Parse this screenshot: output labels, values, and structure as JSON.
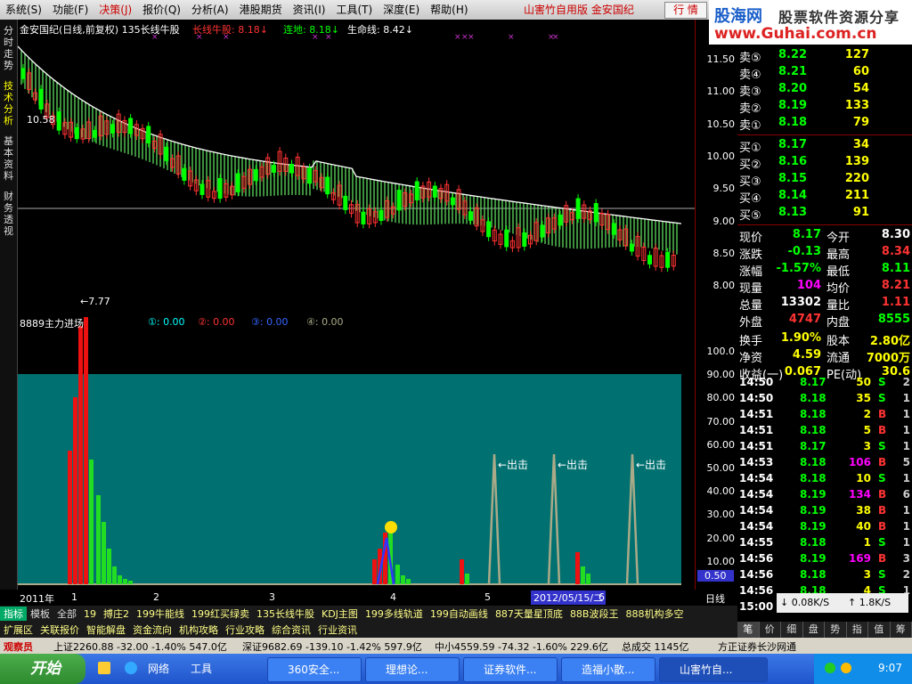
{
  "menu": [
    "系统(S)",
    "功能(F)",
    "决策(J)",
    "报价(Q)",
    "分析(A)",
    "港股期货",
    "资讯(I)",
    "工具(T)",
    "深度(E)",
    "帮助(H)"
  ],
  "menu_active_index": 2,
  "app_title": "山害竹自用版 金安国纪",
  "hq_button": "行 情",
  "logo": {
    "brand": "股海网",
    "slogan": "股票软件资源分享",
    "url": "www.Guhai.com.cn"
  },
  "vtabs": [
    "分时走势",
    "技术分析",
    "基本资料",
    "财务透视"
  ],
  "vtab_active_index": 1,
  "chart_legend": {
    "title": "金安国纪(日线,前复权) 135长线牛股",
    "l1": "长线牛股: 8.18↓",
    "l2": "连地: 8.18↓",
    "l3": "生命线: 8.42↓"
  },
  "price_marks": {
    "high": "10.58",
    "low": "←7.77"
  },
  "indicator_legend": {
    "name": "8889主力进场",
    "v1": "①: 0.00",
    "v2": "②: 0.00",
    "v3": "③: 0.00",
    "v4": "④: 0.00"
  },
  "exit_label": "←出击",
  "price_axis": [
    "11.50",
    "11.00",
    "10.50",
    "10.00",
    "9.50",
    "9.00",
    "8.50",
    "8.00"
  ],
  "ind_axis": [
    "100.0",
    "90.00",
    "80.00",
    "70.00",
    "60.00",
    "50.00",
    "40.00",
    "30.00",
    "20.00",
    "10.00"
  ],
  "ind_axis_current": "0.50",
  "time_axis": {
    "year": "2011年",
    "labels": [
      "1",
      "2",
      "3",
      "4",
      "5",
      "6"
    ],
    "cursor": "2012/05/15/二",
    "period": "日线"
  },
  "quote": {
    "asks": [
      {
        "label": "卖⑤",
        "price": "8.22",
        "vol": "127"
      },
      {
        "label": "卖④",
        "price": "8.21",
        "vol": "60"
      },
      {
        "label": "卖③",
        "price": "8.20",
        "vol": "54"
      },
      {
        "label": "卖②",
        "price": "8.19",
        "vol": "133"
      },
      {
        "label": "卖①",
        "price": "8.18",
        "vol": "79"
      }
    ],
    "bids": [
      {
        "label": "买①",
        "price": "8.17",
        "vol": "34"
      },
      {
        "label": "买②",
        "price": "8.16",
        "vol": "139"
      },
      {
        "label": "买③",
        "price": "8.15",
        "vol": "220"
      },
      {
        "label": "买④",
        "price": "8.14",
        "vol": "211"
      },
      {
        "label": "买⑤",
        "price": "8.13",
        "vol": "91"
      }
    ],
    "stats": [
      {
        "k1": "现价",
        "v1": "8.17",
        "c1": "#0f0",
        "k2": "今开",
        "v2": "8.30",
        "c2": "#fff"
      },
      {
        "k1": "涨跌",
        "v1": "-0.13",
        "c1": "#0f0",
        "k2": "最高",
        "v2": "8.34",
        "c2": "#f33"
      },
      {
        "k1": "涨幅",
        "v1": "-1.57%",
        "c1": "#0f0",
        "k2": "最低",
        "v2": "8.11",
        "c2": "#0f0"
      },
      {
        "k1": "现量",
        "v1": "104",
        "c1": "#f0f",
        "k2": "均价",
        "v2": "8.21",
        "c2": "#f33"
      },
      {
        "k1": "总量",
        "v1": "13302",
        "c1": "#fff",
        "k2": "量比",
        "v2": "1.11",
        "c2": "#f33"
      },
      {
        "k1": "外盘",
        "v1": "4747",
        "c1": "#f33",
        "k2": "内盘",
        "v2": "8555",
        "c2": "#0f0"
      },
      {
        "k1": "换手",
        "v1": "1.90%",
        "c1": "#ff0",
        "k2": "股本",
        "v2": "2.80亿",
        "c2": "#ff0"
      },
      {
        "k1": "净资",
        "v1": "4.59",
        "c1": "#ff0",
        "k2": "流通",
        "v2": "7000万",
        "c2": "#ff0"
      },
      {
        "k1": "收益(一)",
        "v1": "0.067",
        "c1": "#ff0",
        "k2": "PE(动)",
        "v2": "30.6",
        "c2": "#ff0"
      }
    ]
  },
  "ticks": [
    {
      "t": "14:50",
      "p": "8.17",
      "v": "50",
      "s": "S",
      "n": "2"
    },
    {
      "t": "14:50",
      "p": "8.18",
      "v": "35",
      "s": "S",
      "n": "1"
    },
    {
      "t": "14:51",
      "p": "8.18",
      "v": "2",
      "s": "B",
      "n": "1"
    },
    {
      "t": "14:51",
      "p": "8.18",
      "v": "5",
      "s": "B",
      "n": "1"
    },
    {
      "t": "14:51",
      "p": "8.17",
      "v": "3",
      "s": "S",
      "n": "1"
    },
    {
      "t": "14:53",
      "p": "8.18",
      "v": "106",
      "s": "B",
      "n": "5"
    },
    {
      "t": "14:54",
      "p": "8.18",
      "v": "10",
      "s": "S",
      "n": "1"
    },
    {
      "t": "14:54",
      "p": "8.19",
      "v": "134",
      "s": "B",
      "n": "6"
    },
    {
      "t": "14:54",
      "p": "8.19",
      "v": "38",
      "s": "B",
      "n": "1"
    },
    {
      "t": "14:54",
      "p": "8.19",
      "v": "40",
      "s": "B",
      "n": "1"
    },
    {
      "t": "14:55",
      "p": "8.18",
      "v": "1",
      "s": "S",
      "n": "1"
    },
    {
      "t": "14:56",
      "p": "8.19",
      "v": "169",
      "s": "B",
      "n": "3"
    },
    {
      "t": "14:56",
      "p": "8.18",
      "v": "3",
      "s": "S",
      "n": "2"
    },
    {
      "t": "14:56",
      "p": "8.18",
      "v": "4",
      "s": "S",
      "n": "1"
    },
    {
      "t": "15:00",
      "p": "",
      "v": "",
      "s": "",
      "n": ""
    }
  ],
  "speed": {
    "down": "0.08K/S",
    "up": "1.8K/S"
  },
  "right_tabs": [
    "笔",
    "价",
    "细",
    "盘",
    "势",
    "指",
    "值",
    "筹"
  ],
  "indicator_tabs": [
    "指标",
    "模板",
    "全部",
    "19",
    "搏庄2",
    "199牛能线",
    "199红买绿卖",
    "135长线牛股",
    "KDJ主图",
    "199多线轨道",
    "199自动画线",
    "887天量星顶底",
    "88B波段王",
    "888机构多空"
  ],
  "indicator_tabs2": [
    "扩展区",
    "关联报价",
    "智能解盘",
    "资金流向",
    "机构攻略",
    "行业攻略",
    "综合资讯",
    "行业资讯"
  ],
  "status": {
    "user": "观察员",
    "sh": "上证2260.88  -32.00  -1.40%  547.0亿",
    "sz": "深证9682.69  -139.10  -1.42%  597.9亿",
    "zx": "中小4559.59  -74.32  -1.60%  229.6亿",
    "total": "总成交  1145亿",
    "broker": "方正证券长沙网通"
  },
  "taskbar": {
    "start": "开始",
    "quick": [
      "网络",
      "工具"
    ],
    "tasks": [
      "360安全...",
      "理想论...",
      "证券软件...",
      "造福小散...",
      "山害竹自..."
    ],
    "clock": "9:07"
  }
}
